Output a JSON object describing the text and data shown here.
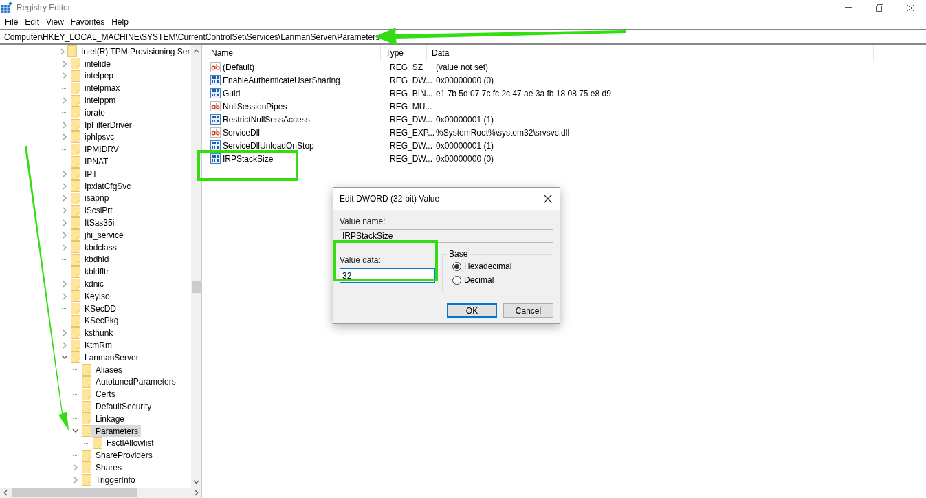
{
  "window": {
    "title": "Registry Editor"
  },
  "menu": [
    "File",
    "Edit",
    "View",
    "Favorites",
    "Help"
  ],
  "address_bar": {
    "value": "Computer\\HKEY_LOCAL_MACHINE\\SYSTEM\\CurrentControlSet\\Services\\LanmanServer\\Parameters"
  },
  "tree": [
    {
      "label": "Intel(R) TPM Provisioning Ser",
      "expanded": false,
      "selected": false
    },
    {
      "label": "intelide",
      "expanded": false,
      "selected": false
    },
    {
      "label": "intelpep",
      "expanded": false,
      "selected": false
    },
    {
      "label": "intelpmax",
      "selected": false
    },
    {
      "label": "intelppm",
      "expanded": false,
      "selected": false
    },
    {
      "label": "iorate",
      "selected": false
    },
    {
      "label": "IpFilterDriver",
      "expanded": false,
      "selected": false
    },
    {
      "label": "iphlpsvc",
      "expanded": false,
      "selected": false
    },
    {
      "label": "IPMIDRV",
      "selected": false
    },
    {
      "label": "IPNAT",
      "selected": false
    },
    {
      "label": "IPT",
      "expanded": false,
      "selected": false
    },
    {
      "label": "IpxlatCfgSvc",
      "expanded": false,
      "selected": false
    },
    {
      "label": "isapnp",
      "expanded": false,
      "selected": false
    },
    {
      "label": "iScsiPrt",
      "expanded": false,
      "selected": false
    },
    {
      "label": "ItSas35i",
      "expanded": false,
      "selected": false
    },
    {
      "label": "jhi_service",
      "expanded": false,
      "selected": false
    },
    {
      "label": "kbdclass",
      "expanded": false,
      "selected": false
    },
    {
      "label": "kbdhid",
      "selected": false
    },
    {
      "label": "kbldfltr",
      "selected": false
    },
    {
      "label": "kdnic",
      "expanded": false,
      "selected": false
    },
    {
      "label": "KeyIso",
      "expanded": false,
      "selected": false
    },
    {
      "label": "KSecDD",
      "selected": false
    },
    {
      "label": "KSecPkg",
      "selected": false
    },
    {
      "label": "ksthunk",
      "expanded": false,
      "selected": false
    },
    {
      "label": "KtmRm",
      "expanded": false,
      "selected": false
    },
    {
      "label": "LanmanServer",
      "expanded": true,
      "selected": false,
      "children": [
        {
          "label": "Aliases",
          "selected": false
        },
        {
          "label": "AutotunedParameters",
          "selected": false
        },
        {
          "label": "Certs",
          "selected": false
        },
        {
          "label": "DefaultSecurity",
          "selected": false
        },
        {
          "label": "Linkage",
          "selected": false
        },
        {
          "label": "Parameters",
          "expanded": true,
          "selected": true,
          "children": [
            {
              "label": "FsctlAllowlist",
              "selected": false
            }
          ]
        },
        {
          "label": "ShareProviders",
          "selected": false
        },
        {
          "label": "Shares",
          "expanded": false,
          "selected": false
        },
        {
          "label": "TriggerInfo",
          "expanded": false,
          "selected": false
        }
      ]
    }
  ],
  "values": {
    "columns": [
      "Name",
      "Type",
      "Data"
    ],
    "rows": [
      {
        "kind": "string",
        "name": "(Default)",
        "type": "REG_SZ",
        "data": "(value not set)"
      },
      {
        "kind": "binary",
        "name": "EnableAuthenticateUserSharing",
        "type": "REG_DW...",
        "data": "0x00000000 (0)"
      },
      {
        "kind": "binary",
        "name": "Guid",
        "type": "REG_BIN...",
        "data": "e1 7b 5d 07 7c fc 2c 47 ae 3a fb 18 08 75 e8 d9"
      },
      {
        "kind": "string",
        "name": "NullSessionPipes",
        "type": "REG_MU..."
      },
      {
        "kind": "binary",
        "name": "RestrictNullSessAccess",
        "type": "REG_DW...",
        "data": "0x00000001 (1)"
      },
      {
        "kind": "string",
        "name": "ServiceDll",
        "type": "REG_EXP...",
        "data": "%SystemRoot%\\system32\\srvsvc.dll"
      },
      {
        "kind": "binary",
        "name": "ServiceDllUnloadOnStop",
        "type": "REG_DW...",
        "data": "0x00000001 (1)"
      },
      {
        "kind": "binary",
        "name": "IRPStackSize",
        "type": "REG_DW...",
        "data": "0x00000000 (0)"
      }
    ]
  },
  "dialog": {
    "title": "Edit DWORD (32-bit) Value",
    "value_name_label": "Value name:",
    "value_name": "IRPStackSize",
    "value_data_label": "Value data:",
    "value_data": "32",
    "base_label": "Base",
    "bases": [
      {
        "label": "Hexadecimal",
        "selected": true
      },
      {
        "label": "Decimal",
        "selected": false
      }
    ],
    "buttons": [
      {
        "label": "OK",
        "default": true
      },
      {
        "label": "Cancel",
        "default": false
      }
    ]
  }
}
